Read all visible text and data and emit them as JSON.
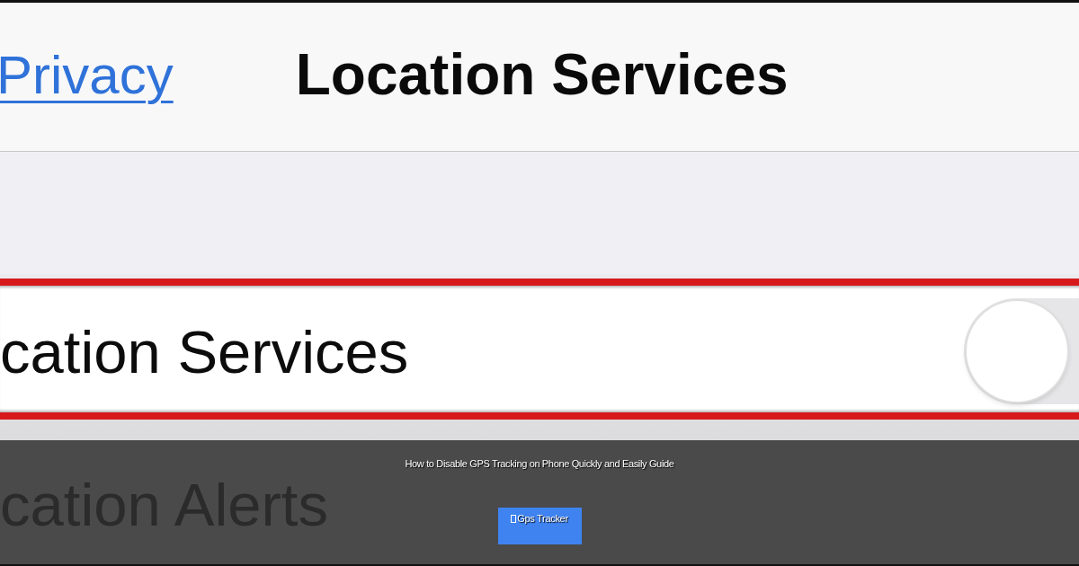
{
  "nav_bar": {
    "back_link": "Privacy",
    "title": "Location Services"
  },
  "settings": [
    {
      "label": "cation Services",
      "kind": "toggle",
      "on": false,
      "highlighted": true
    },
    {
      "label": "cation Alerts",
      "kind": "plain",
      "highlighted": false
    }
  ],
  "overlay": {
    "caption": "How to Disable GPS Tracking on Phone Quickly and Easily Guide",
    "button": "Gps Tracker"
  }
}
